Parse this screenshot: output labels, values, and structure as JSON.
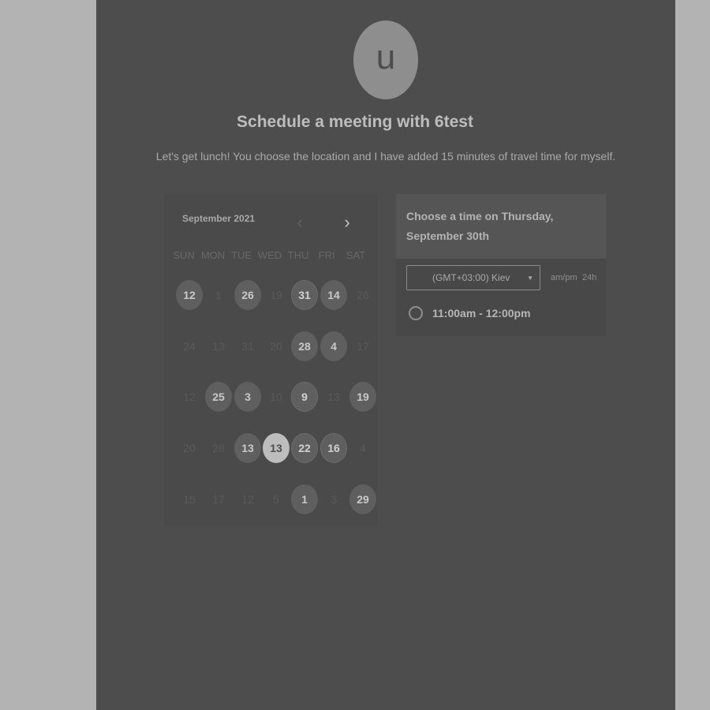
{
  "profile": {
    "avatar_letter": "u",
    "title": "Schedule a meeting with 6test",
    "description": "Let's get lunch! You choose the location and I have added 15 minutes of travel time for myself."
  },
  "calendar": {
    "month_label": "September 2021",
    "prev_icon": "chevron-left-icon",
    "next_icon": "chevron-right-icon",
    "weekdays": [
      "SUN",
      "MON",
      "TUE",
      "WED",
      "THU",
      "FRI",
      "SAT"
    ],
    "weeks": [
      [
        {
          "label": "12",
          "state": "available"
        },
        {
          "label": "1",
          "state": "disabled"
        },
        {
          "label": "26",
          "state": "available"
        },
        {
          "label": "19",
          "state": "disabled"
        },
        {
          "label": "31",
          "state": "available-dotted"
        },
        {
          "label": "14",
          "state": "available"
        },
        {
          "label": "26",
          "state": "disabled"
        }
      ],
      [
        {
          "label": "24",
          "state": "disabled"
        },
        {
          "label": "13",
          "state": "disabled"
        },
        {
          "label": "31",
          "state": "disabled"
        },
        {
          "label": "20",
          "state": "disabled"
        },
        {
          "label": "28",
          "state": "available"
        },
        {
          "label": "4",
          "state": "available"
        },
        {
          "label": "17",
          "state": "disabled"
        }
      ],
      [
        {
          "label": "12",
          "state": "disabled"
        },
        {
          "label": "25",
          "state": "available"
        },
        {
          "label": "3",
          "state": "available"
        },
        {
          "label": "10",
          "state": "disabled"
        },
        {
          "label": "9",
          "state": "available-dotted"
        },
        {
          "label": "13",
          "state": "disabled"
        },
        {
          "label": "19",
          "state": "available"
        }
      ],
      [
        {
          "label": "20",
          "state": "disabled"
        },
        {
          "label": "28",
          "state": "disabled"
        },
        {
          "label": "13",
          "state": "available"
        },
        {
          "label": "13",
          "state": "selected"
        },
        {
          "label": "22",
          "state": "available-dotted"
        },
        {
          "label": "16",
          "state": "available-dotted"
        },
        {
          "label": "4",
          "state": "disabled"
        }
      ],
      [
        {
          "label": "15",
          "state": "disabled"
        },
        {
          "label": "17",
          "state": "disabled"
        },
        {
          "label": "12",
          "state": "disabled"
        },
        {
          "label": "5",
          "state": "disabled"
        },
        {
          "label": "1",
          "state": "available"
        },
        {
          "label": "3",
          "state": "disabled"
        },
        {
          "label": "29",
          "state": "available"
        }
      ]
    ]
  },
  "times": {
    "heading": "Choose a time on Thursday, September 30th",
    "timezone": "(GMT+03:00) Kiev",
    "format_ampm": "am/pm",
    "format_24h": "24h",
    "slots": [
      {
        "label": "11:00am - 12:00pm"
      }
    ]
  },
  "colors": {
    "page_bg": "#b3b3b3",
    "panel_bg": "#4d4d4d",
    "selected_day": "#bdbdbd"
  }
}
